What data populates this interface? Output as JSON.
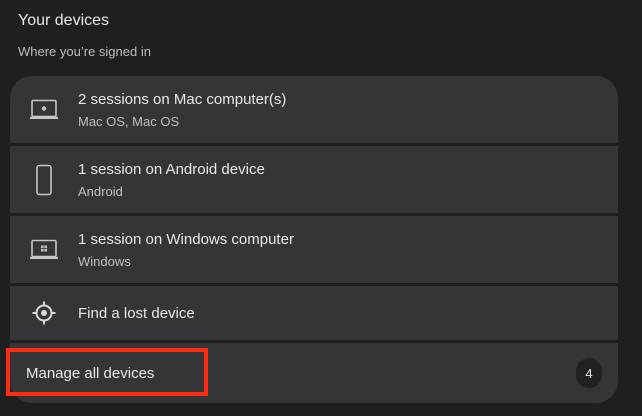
{
  "section": {
    "title": "Your devices",
    "subtitle": "Where you’re signed in"
  },
  "devices": [
    {
      "icon": "mac-laptop-icon",
      "primary": "2 sessions on Mac computer(s)",
      "secondary": "Mac OS, Mac OS"
    },
    {
      "icon": "android-phone-icon",
      "primary": "1 session on Android device",
      "secondary": "Android"
    },
    {
      "icon": "windows-laptop-icon",
      "primary": "1 session on Windows computer",
      "secondary": "Windows"
    }
  ],
  "find_device": {
    "icon": "locate-target-icon",
    "label": "Find a lost device"
  },
  "manage": {
    "label": "Manage all devices",
    "count": "4"
  },
  "colors": {
    "background": "#1f1f1f",
    "card": "#333537",
    "highlight": "#ff2a13"
  }
}
